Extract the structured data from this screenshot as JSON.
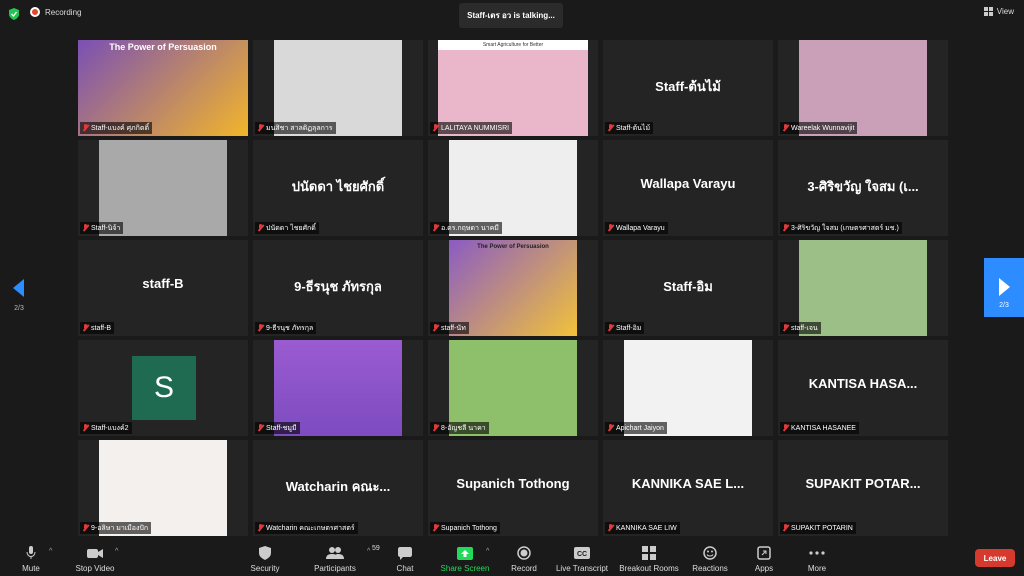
{
  "topbar": {
    "recording_label": "Recording",
    "talking_text": "Staff-เตร อว is talking...",
    "view_label": "View"
  },
  "tiles": [
    {
      "label": "Staff-แบงค์ ศุภกิตติ์",
      "display": "",
      "kind": "video"
    },
    {
      "label": "มนสิชา สาลดิฏลุลการ",
      "display": "",
      "kind": "video"
    },
    {
      "label": "LALITAYA NUMMISRI",
      "display": "",
      "kind": "video",
      "banner": "Smart Agriculture for Better"
    },
    {
      "label": "Staff-ต้นไม้",
      "display": "Staff-ต้นไม้",
      "kind": "name"
    },
    {
      "label": "Wareelak Wunnavijit",
      "display": "",
      "kind": "video"
    },
    {
      "label": "Staff-นิจ้า",
      "display": "",
      "kind": "video"
    },
    {
      "label": "ปนัดดา ไชยศักดิ์",
      "display": "ปนัดดา ไชยศักดิ์",
      "kind": "name"
    },
    {
      "label": "อ.ดร.กฤษดา นาคมี",
      "display": "",
      "kind": "video"
    },
    {
      "label": "Wallapa Varayu",
      "display": "Wallapa Varayu",
      "kind": "name"
    },
    {
      "label": "3-ศิริขวัญ ใจสม (เกษตรศาสตร์ มช.)",
      "display": "3-ศิริขวัญ ใจสม (เ...",
      "kind": "name"
    },
    {
      "label": "staff-B",
      "display": "staff-B",
      "kind": "name"
    },
    {
      "label": "9-ธีรนุช ภัทรกุล",
      "display": "9-ธีรนุช ภัทรกุล",
      "kind": "name"
    },
    {
      "label": "staff-นัท",
      "display": "",
      "kind": "video",
      "banner": "The Power of Persuasion"
    },
    {
      "label": "Staff-อิม",
      "display": "Staff-อิม",
      "kind": "name"
    },
    {
      "label": "staff-เจน",
      "display": "",
      "kind": "video"
    },
    {
      "label": "Staff-แบงค์2",
      "display": "",
      "kind": "avatar",
      "avatar_letter": "S"
    },
    {
      "label": "Staff-ชมูมี",
      "display": "",
      "kind": "video"
    },
    {
      "label": "8-อัญชลี นาคา",
      "display": "",
      "kind": "video"
    },
    {
      "label": "Apichart Jaiyon",
      "display": "",
      "kind": "video"
    },
    {
      "label": "KANTISA HASANEE",
      "display": "KANTISA HASA...",
      "kind": "name"
    },
    {
      "label": "9-อลิษา มาเมืองปัก",
      "display": "",
      "kind": "video"
    },
    {
      "label": "Watcharin คณะเกษตรศาสตร์",
      "display": "Watcharin คณะ...",
      "kind": "name"
    },
    {
      "label": "Supanich Tothong",
      "display": "Supanich Tothong",
      "kind": "name"
    },
    {
      "label": "KANNIKA SAE LIW",
      "display": "KANNIKA SAE L...",
      "kind": "name"
    },
    {
      "label": "SUPAKIT POTARIN",
      "display": "SUPAKIT POTAR...",
      "kind": "name"
    }
  ],
  "first_banner": "The Power of Persuasion",
  "pagination": {
    "left": "2/3",
    "right": "2/3"
  },
  "toolbar": {
    "mute": "Mute",
    "stop_video": "Stop Video",
    "security": "Security",
    "participants": "Participants",
    "participants_count": "59",
    "chat": "Chat",
    "share_screen": "Share Screen",
    "record": "Record",
    "live_transcript": "Live Transcript",
    "breakout_rooms": "Breakout Rooms",
    "reactions": "Reactions",
    "apps": "Apps",
    "more": "More",
    "leave": "Leave"
  },
  "colors": {
    "accent": "#2d8cff",
    "leave": "#d63a2f",
    "share": "#23d959",
    "muted": "#e03a3a"
  }
}
